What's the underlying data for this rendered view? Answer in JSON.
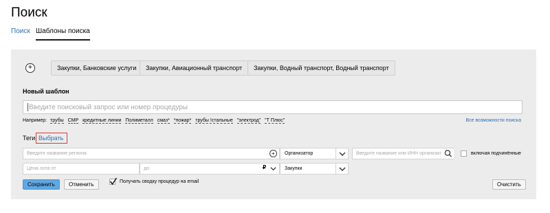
{
  "page": {
    "title": "Поиск"
  },
  "tabs": [
    {
      "label": "Поиск",
      "active": false
    },
    {
      "label": "Шаблоны поиска",
      "active": true
    }
  ],
  "saved_templates": [
    "Закупки, Банковские услуги",
    "Закупки, Авиационный транспорт",
    "Закупки, Водный транспорт, Водный транспорт"
  ],
  "new_template": {
    "heading": "Новый шаблон",
    "query_placeholder": "Введите поисковый запрос или номер процедуры",
    "query_value": "",
    "examples_prefix": "Например:",
    "examples": [
      "трубы",
      "СМР",
      "кредитные линии",
      "Полиметалл",
      "смаз*",
      "*пожар*",
      "трубы !стальные",
      "\"электрод\"",
      "\"Т Плюс\""
    ],
    "all_features_link": "Все возможности поиска"
  },
  "tags": {
    "label": "Теги",
    "choose_link": "Выбрать"
  },
  "filters": {
    "region_placeholder": "Введите название региона",
    "role_select": "Организатор",
    "inn_placeholder": "Введите название или ИНН организатора",
    "include_subordinates_label": "включая подчинённые",
    "include_subordinates_checked": false,
    "price_from_placeholder": "Цена лота от",
    "price_to_placeholder": "до",
    "currency_symbol": "₽",
    "type_select": "Закупки"
  },
  "actions": {
    "save_label": "Сохранить",
    "cancel_label": "Отменить",
    "email_label": "Получать сводку процедур на email",
    "email_checked": true,
    "clear_label": "Очистить"
  },
  "colors": {
    "link": "#2f6fb0",
    "primary_button": "#5fa8e3",
    "panel_bg": "#ececec",
    "highlight_box": "#d93a3a"
  }
}
